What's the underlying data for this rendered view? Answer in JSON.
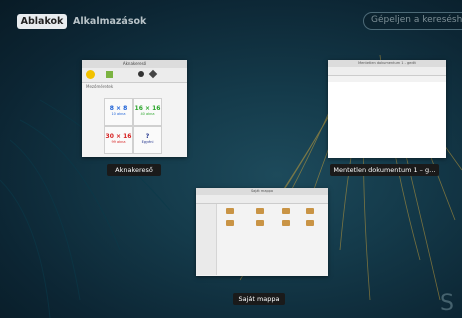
{
  "overview": {
    "tabs": [
      "Ablakok",
      "Alkalmazások"
    ],
    "search_placeholder": "Gépeljen a kereséshez…",
    "windows": [
      {
        "caption": "Aknakereső",
        "title": "Aknakereső",
        "sections_label": "Mezőméretek",
        "sizes": [
          {
            "size": "8 × 8",
            "mines": "10 akna",
            "color": "#1a5fd6"
          },
          {
            "size": "16 × 16",
            "mines": "40 akna",
            "color": "#2aa52a"
          },
          {
            "size": "30 × 16",
            "mines": "99 akna",
            "color": "#d62020"
          },
          {
            "size": "?",
            "mines": "Egyéni",
            "color": "#1c2f8a"
          }
        ]
      },
      {
        "caption": "Mentetlen dokumentum 1 – g…",
        "title": "Mentetlen dokumentum 1 - gedit"
      },
      {
        "caption": "Saját mappa",
        "title": "Saját mappa"
      }
    ]
  },
  "colors": {
    "accent_wallpaper": "#c9a13a",
    "background": "#0f2f3f"
  }
}
